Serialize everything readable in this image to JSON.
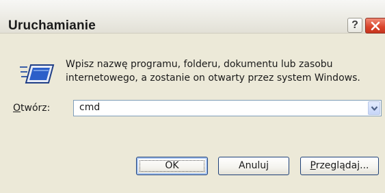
{
  "window": {
    "title": "Uruchamianie",
    "help_glyph": "?"
  },
  "icons": {
    "run": "run-program-icon",
    "help": "help-icon",
    "close": "close-icon",
    "dropdown": "chevron-down-icon"
  },
  "description": {
    "line1": "Wpisz nazwę programu, folderu, dokumentu lub zasobu",
    "line2": "internetowego, a zostanie on otwarty przez system Windows."
  },
  "open": {
    "label_accel": "O",
    "label_rest": "twórz:",
    "value": "cmd"
  },
  "buttons": {
    "ok": "OK",
    "cancel": "Anuluj",
    "browse_accel": "P",
    "browse_rest": "rzeglądaj..."
  },
  "colors": {
    "dialog_bg": "#ece9d8",
    "close_red": "#d9432a",
    "field_border": "#7f9db9"
  }
}
